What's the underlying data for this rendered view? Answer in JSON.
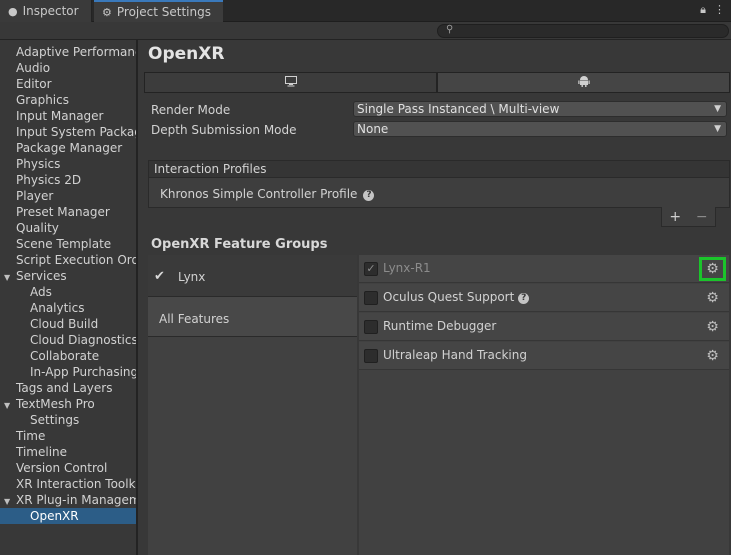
{
  "tabs": [
    {
      "label": "Inspector",
      "icon": "info-icon"
    },
    {
      "label": "Project Settings",
      "icon": "gear-icon"
    }
  ],
  "window_icons": [
    "lock-icon",
    "menu-icon"
  ],
  "search": {
    "placeholder": "",
    "icon": "search-icon"
  },
  "sidebar": {
    "items": [
      {
        "label": "Adaptive Performance",
        "indent": 0
      },
      {
        "label": "Audio",
        "indent": 0
      },
      {
        "label": "Editor",
        "indent": 0
      },
      {
        "label": "Graphics",
        "indent": 0
      },
      {
        "label": "Input Manager",
        "indent": 0
      },
      {
        "label": "Input System Package",
        "indent": 0
      },
      {
        "label": "Package Manager",
        "indent": 0
      },
      {
        "label": "Physics",
        "indent": 0
      },
      {
        "label": "Physics 2D",
        "indent": 0
      },
      {
        "label": "Player",
        "indent": 0
      },
      {
        "label": "Preset Manager",
        "indent": 0
      },
      {
        "label": "Quality",
        "indent": 0
      },
      {
        "label": "Scene Template",
        "indent": 0
      },
      {
        "label": "Script Execution Order",
        "indent": 0
      },
      {
        "label": "Services",
        "indent": 0,
        "foldout": true
      },
      {
        "label": "Ads",
        "indent": 1
      },
      {
        "label": "Analytics",
        "indent": 1
      },
      {
        "label": "Cloud Build",
        "indent": 1
      },
      {
        "label": "Cloud Diagnostics",
        "indent": 1
      },
      {
        "label": "Collaborate",
        "indent": 1
      },
      {
        "label": "In-App Purchasing",
        "indent": 1
      },
      {
        "label": "Tags and Layers",
        "indent": 0
      },
      {
        "label": "TextMesh Pro",
        "indent": 0,
        "foldout": true
      },
      {
        "label": "Settings",
        "indent": 1
      },
      {
        "label": "Time",
        "indent": 0
      },
      {
        "label": "Timeline",
        "indent": 0
      },
      {
        "label": "Version Control",
        "indent": 0
      },
      {
        "label": "XR Interaction Toolkit",
        "indent": 0
      },
      {
        "label": "XR Plug-in Management",
        "indent": 0,
        "foldout": true
      },
      {
        "label": "OpenXR",
        "indent": 1,
        "selected": true
      }
    ]
  },
  "main": {
    "title": "OpenXR",
    "platform_tabs": [
      {
        "icon": "desktop-icon",
        "active": false
      },
      {
        "icon": "android-icon",
        "active": true
      }
    ],
    "render_mode": {
      "label": "Render Mode",
      "value": "Single Pass Instanced \\ Multi-view"
    },
    "depth_mode": {
      "label": "Depth Submission Mode",
      "value": "None"
    },
    "interaction_profiles": {
      "header": "Interaction Profiles",
      "items": [
        "Khronos Simple Controller Profile"
      ]
    },
    "feature_groups": {
      "title": "OpenXR Feature Groups",
      "groups": [
        {
          "label": "Lynx",
          "checked": true
        },
        {
          "label": "All Features",
          "checked": false
        }
      ],
      "features": [
        {
          "label": "Lynx-R1",
          "checked": true,
          "disabled": true,
          "help": false,
          "highlight": true
        },
        {
          "label": "Oculus Quest Support",
          "checked": false,
          "disabled": false,
          "help": true,
          "highlight": false
        },
        {
          "label": "Runtime Debugger",
          "checked": false,
          "disabled": false,
          "help": false,
          "highlight": false
        },
        {
          "label": "Ultraleap Hand Tracking",
          "checked": false,
          "disabled": false,
          "help": false,
          "highlight": false
        }
      ]
    }
  },
  "colors": {
    "accent": "#3a79bb",
    "selection": "#2c5d87",
    "highlight": "#1bc42b",
    "background": "#383838"
  }
}
